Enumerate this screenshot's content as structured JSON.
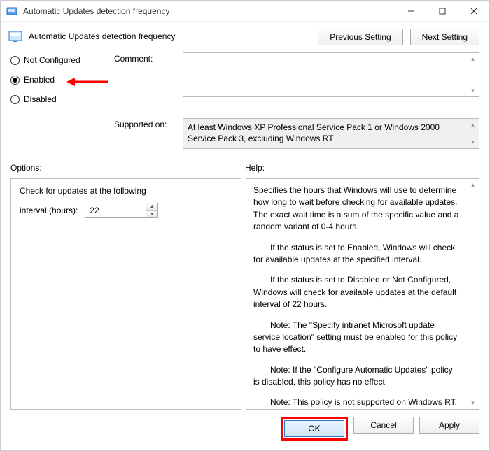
{
  "window": {
    "title": "Automatic Updates detection frequency"
  },
  "header": {
    "title": "Automatic Updates detection frequency",
    "prev": "Previous Setting",
    "next": "Next Setting"
  },
  "radios": {
    "not_configured": "Not Configured",
    "enabled": "Enabled",
    "disabled": "Disabled",
    "selected": "enabled"
  },
  "meta": {
    "comment_label": "Comment:",
    "comment_value": "",
    "supported_label": "Supported on:",
    "supported_value": "At least Windows XP Professional Service Pack 1 or Windows 2000 Service Pack 3, excluding Windows RT"
  },
  "labels": {
    "options": "Options:",
    "help": "Help:"
  },
  "options": {
    "line1": "Check for updates at the following",
    "interval_label": "interval (hours):",
    "interval_value": "22"
  },
  "help": {
    "p1": "Specifies the hours that Windows will use to determine how long to wait before checking for available updates. The exact wait time is a sum of the specific value and a random variant of 0-4 hours.",
    "p2": "If the status is set to Enabled, Windows will check for available updates at the specified interval.",
    "p3": "If the status is set to Disabled or Not Configured, Windows will check for available updates at the default interval of 22 hours.",
    "p4": "Note: The \"Specify intranet Microsoft update service location\" setting must be enabled for this policy to have effect.",
    "p5": "Note: If the \"Configure Automatic Updates\" policy is disabled, this policy has no effect.",
    "p6": "Note: This policy is not supported on Windows RT. Setting this policy will not have any effect on Windows RT PCs."
  },
  "footer": {
    "ok": "OK",
    "cancel": "Cancel",
    "apply": "Apply"
  }
}
